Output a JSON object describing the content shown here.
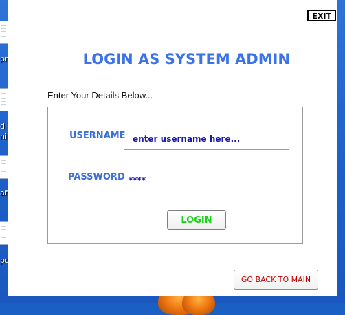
{
  "desktop": {
    "icons": [
      {
        "label": "pro",
        "icon": "document-icon"
      },
      {
        "label": "d",
        "label2": "nip",
        "icon": "document-icon"
      },
      {
        "label": "afx",
        "icon": "document-icon"
      },
      {
        "label": "po",
        "icon": "document-icon"
      }
    ]
  },
  "window": {
    "exit_label": "EXIT",
    "title": "LOGIN AS SYSTEM ADMIN",
    "subtitle": "Enter Your Details Below...",
    "form": {
      "username_label": "USERNAME",
      "username_value": "enter username here...",
      "password_label": "PASSWORD",
      "password_value": "****",
      "login_label": "LOGIN"
    },
    "back_label": "GO BACK TO MAIN"
  },
  "colors": {
    "title": "#3a72e8",
    "field_label": "#3c6fd6",
    "input_text": "#1a1aa8",
    "login_text": "#11d611",
    "back_text": "#c40000",
    "desktop_bg": "#1e5fc9"
  }
}
